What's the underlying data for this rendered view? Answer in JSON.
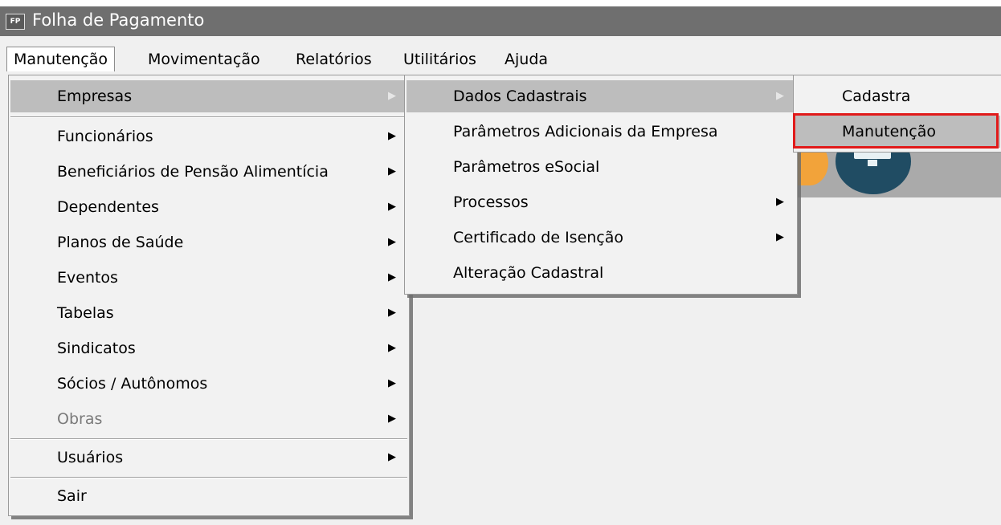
{
  "window": {
    "icon_text": "FP",
    "title": "Folha de Pagamento"
  },
  "menubar": {
    "items": [
      {
        "label": "Manutenção"
      },
      {
        "label": "Movimentação"
      },
      {
        "label": "Relatórios"
      },
      {
        "label": "Utilitários"
      },
      {
        "label": "Ajuda"
      }
    ]
  },
  "manutencao_menu": {
    "items": [
      {
        "label": "Empresas"
      },
      {
        "label": "Funcionários"
      },
      {
        "label": "Beneficiários de Pensão Alimentícia"
      },
      {
        "label": "Dependentes"
      },
      {
        "label": "Planos de Saúde"
      },
      {
        "label": "Eventos"
      },
      {
        "label": "Tabelas"
      },
      {
        "label": "Sindicatos"
      },
      {
        "label": "Sócios / Autônomos"
      },
      {
        "label": "Obras"
      },
      {
        "label": "Usuários"
      },
      {
        "label": "Sair"
      }
    ]
  },
  "empresas_menu": {
    "items": [
      {
        "label": "Dados Cadastrais"
      },
      {
        "label": "Parâmetros Adicionais da Empresa"
      },
      {
        "label": "Parâmetros eSocial"
      },
      {
        "label": "Processos"
      },
      {
        "label": "Certificado de Isenção"
      },
      {
        "label": "Alteração Cadastral"
      }
    ]
  },
  "dados_menu": {
    "items": [
      {
        "label": "Cadastra"
      },
      {
        "label": "Manutenção"
      }
    ]
  },
  "colors": {
    "highlight": "#e11a1a",
    "title_bar": "#6f6f6f"
  }
}
